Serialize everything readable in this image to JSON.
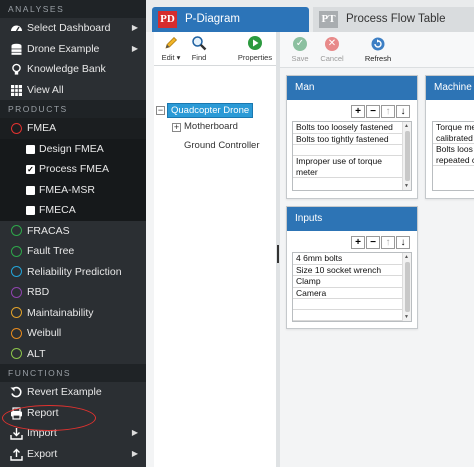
{
  "sidebar": {
    "analyses_header": "ANALYSES",
    "select_dashboard": "Select Dashboard",
    "drone_example": "Drone Example",
    "knowledge_bank": "Knowledge Bank",
    "view_all": "View All",
    "products_header": "PRODUCTS",
    "fmea": "FMEA",
    "design_fmea": "Design FMEA",
    "process_fmea": "Process FMEA",
    "fmea_msr": "FMEA-MSR",
    "fmeca": "FMECA",
    "fracas": "FRACAS",
    "fault_tree": "Fault Tree",
    "reliability_prediction": "Reliability Prediction",
    "rbd": "RBD",
    "maintainability": "Maintainability",
    "weibull": "Weibull",
    "alt": "ALT",
    "functions_header": "FUNCTIONS",
    "revert_example": "Revert Example",
    "report": "Report",
    "import": "Import",
    "export": "Export",
    "colors": {
      "fmea": "#e0322f",
      "fracas": "#2ea64a",
      "fault_tree": "#2ea64a",
      "reliability_prediction": "#23a3d6",
      "rbd": "#8e44ad",
      "maintainability": "#e0a12a",
      "weibull": "#e58a1f",
      "alt": "#8bc34a"
    }
  },
  "tabs": {
    "pd_badge": "PD",
    "pd_label": "P-Diagram",
    "pt_badge": "PT",
    "pt_label": "Process Flow Table"
  },
  "tree_toolbar": {
    "edit": "Edit",
    "find": "Find",
    "properties": "Properties"
  },
  "tree": {
    "root": "Quadcopter Drone",
    "motherboard": "Motherboard",
    "ground_controller": "Ground Controller",
    "expanded_glyph": "−",
    "collapsed_glyph": "+"
  },
  "diagram_toolbar": {
    "save": "Save",
    "cancel": "Cancel",
    "refresh": "Refresh"
  },
  "panels": {
    "man": {
      "title": "Man",
      "rows": [
        "Bolts too loosely fastened",
        "Bolts too tightly fastened",
        "",
        "Improper use of torque meter"
      ]
    },
    "machine": {
      "title": "Machine",
      "rows": [
        "Torque me",
        "calibrated",
        "Bolts loos",
        "repeated c"
      ]
    },
    "inputs": {
      "title": "Inputs",
      "rows": [
        "4 6mm bolts",
        "Size 10 socket wrench",
        "Clamp",
        "Camera",
        "",
        ""
      ]
    },
    "buttons": {
      "add": "+",
      "remove": "−",
      "up": "↑",
      "down": "↓"
    }
  }
}
